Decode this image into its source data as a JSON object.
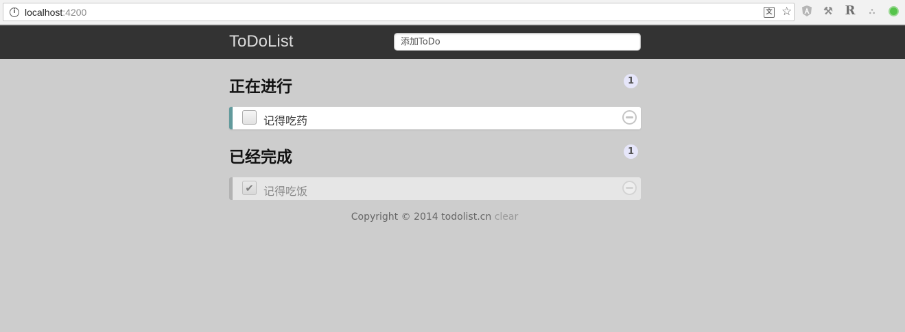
{
  "browser": {
    "url_host": "localhost",
    "url_port": ":4200",
    "icons": [
      "info-icon",
      "translate-icon",
      "star-icon",
      "angular-extension-icon",
      "tool-extension-icon",
      "r-extension-icon",
      "tree-extension-icon",
      "status-extension-icon"
    ],
    "translate_glyph": "文",
    "star_glyph": "☆",
    "info_glyph": "i",
    "r_glyph": "R",
    "tool_glyph": "⚒",
    "tree_glyph": "⛬"
  },
  "app": {
    "title": "ToDoList",
    "add_placeholder": "添加ToDo"
  },
  "sections": {
    "in_progress": {
      "title": "正在进行",
      "count": "1",
      "items": [
        {
          "text": "记得吃药",
          "checked": false
        }
      ]
    },
    "completed": {
      "title": "已经完成",
      "count": "1",
      "items": [
        {
          "text": "记得吃饭",
          "checked": true,
          "check_glyph": "✔"
        }
      ]
    }
  },
  "footer": {
    "copyright": "Copyright © 2014 todolist.cn",
    "clear_label": "clear"
  },
  "colors": {
    "header_bg": "#333333",
    "page_bg": "#cdcdcd",
    "active_accent": "#629a9c",
    "done_accent": "#b3b3b3",
    "badge_bg": "#e6e6fa"
  }
}
